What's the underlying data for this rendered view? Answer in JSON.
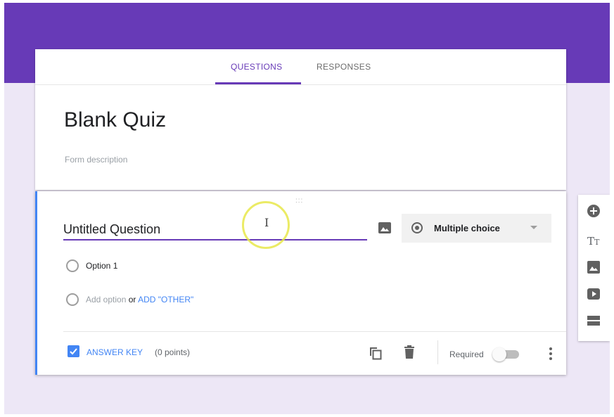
{
  "tabs": [
    {
      "label": "QUESTIONS",
      "active": true
    },
    {
      "label": "RESPONSES",
      "active": false
    }
  ],
  "form": {
    "title": "Blank Quiz",
    "description_placeholder": "Form description"
  },
  "question": {
    "title": "Untitled Question",
    "drag_handle": ":::",
    "type_label": "Multiple choice",
    "options": [
      {
        "label": "Option 1"
      }
    ],
    "add_option_label": "Add option",
    "or_label": "or",
    "add_other_label": "ADD \"OTHER\"",
    "answer_key_label": "ANSWER KEY",
    "points_label": "(0 points)",
    "required_label": "Required",
    "required": false
  },
  "side_toolbar": {
    "text_icon_glyph": "T",
    "text_icon_glyph_small": "T"
  },
  "colors": {
    "accent": "#673ab7",
    "background": "#ede7f6",
    "link_blue": "#4285f4"
  },
  "icons": [
    "image-icon",
    "radio-icon",
    "chevron-down-icon",
    "checkbox-icon",
    "duplicate-icon",
    "trash-icon",
    "more-vert-icon",
    "add-circle-icon",
    "title-text-icon",
    "add-image-icon",
    "video-icon",
    "section-icon"
  ]
}
